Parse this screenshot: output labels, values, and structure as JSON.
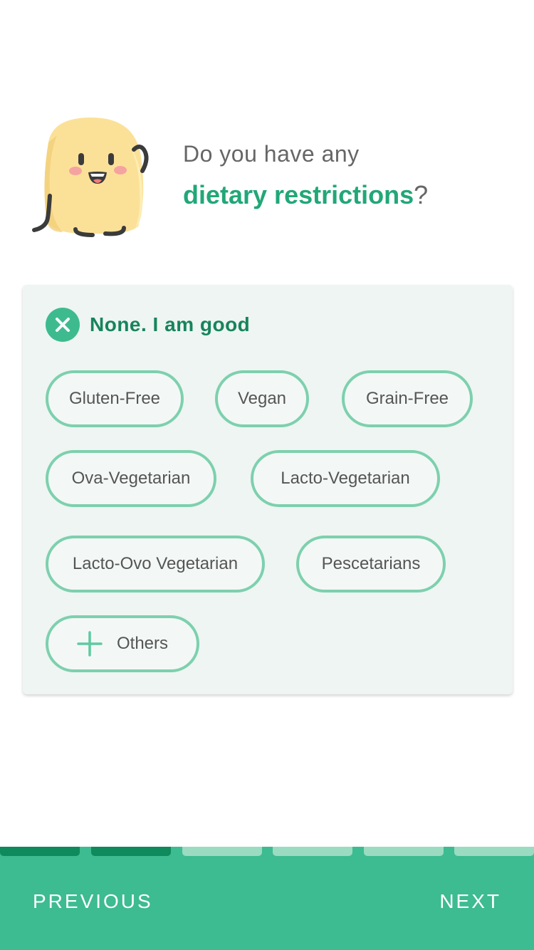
{
  "question": {
    "prefix": "Do you have any",
    "highlight": "dietary restrictions",
    "suffix": "?"
  },
  "none_option": {
    "label": "None. I am good"
  },
  "options": [
    "Gluten-Free",
    "Vegan",
    "Grain-Free",
    "Ova-Vegetarian",
    "Lacto-Vegetarian",
    "Lacto-Ovo Vegetarian",
    "Pescetarians"
  ],
  "others": {
    "label": "Others"
  },
  "progress": {
    "completed_steps": 2,
    "total_steps": 6
  },
  "nav": {
    "previous_label": "PREVIOUS",
    "next_label": "NEXT"
  },
  "icons": {
    "mascot": "potato-mascot-icon",
    "none": "close-icon",
    "others": "plus-icon"
  },
  "colors": {
    "accent": "#22a778",
    "chip_border": "#7dd0ae",
    "card_bg": "#eef5f2",
    "nav_bg": "#3dbb91",
    "progress_done": "#0e8a5c",
    "progress_todo": "#9adbc2"
  }
}
